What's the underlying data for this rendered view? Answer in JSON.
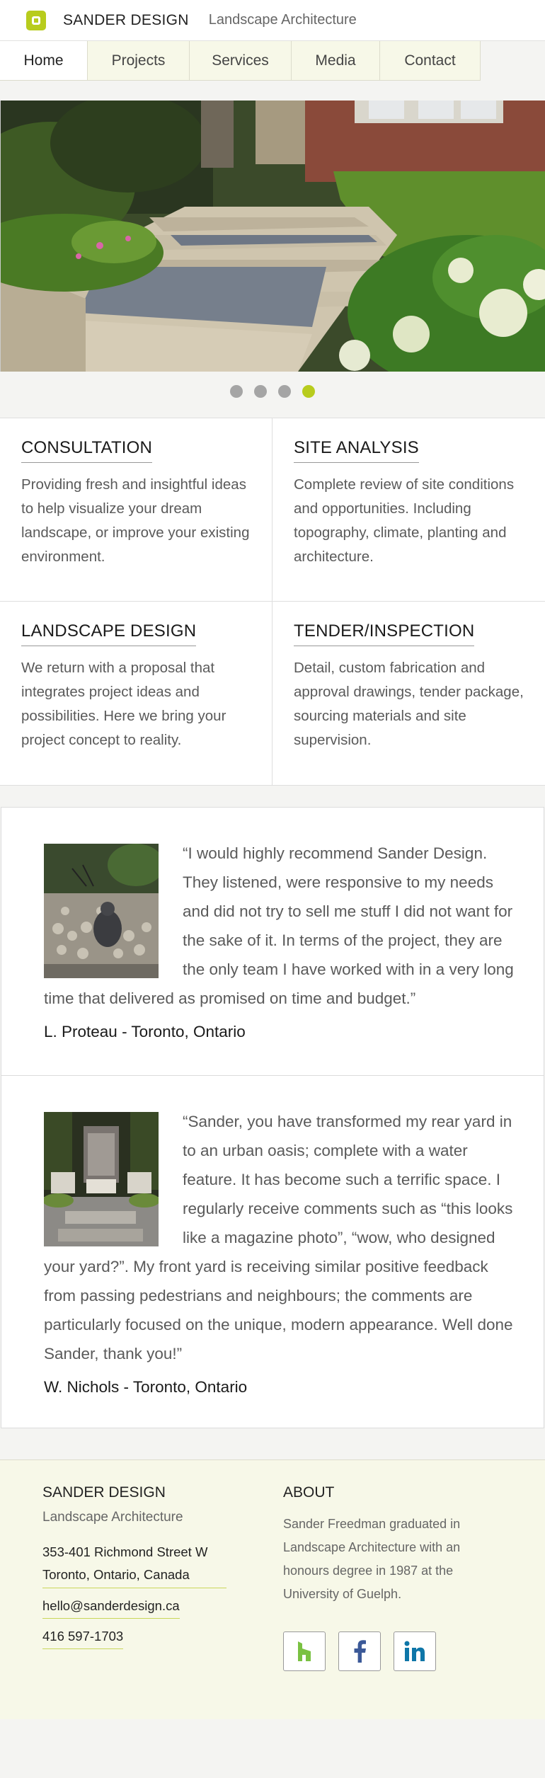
{
  "header": {
    "brand_name": "SANDER DESIGN",
    "brand_tagline": "Landscape Architecture"
  },
  "nav": {
    "items": [
      "Home",
      "Projects",
      "Services",
      "Media",
      "Contact"
    ],
    "active": "Home"
  },
  "slider": {
    "slide_count": 4,
    "active_index": 4
  },
  "services": [
    {
      "title": "CONSULTATION",
      "description": "Providing fresh and insightful ideas to help visualize your dream landscape, or improve your existing environment."
    },
    {
      "title": "SITE ANALYSIS",
      "description": "Complete review of site conditions and opportunities. Including topography, climate, planting and architecture."
    },
    {
      "title": "LANDSCAPE DESIGN",
      "description": "We return with a proposal that integrates project ideas and possibilities. Here we bring your project concept to reality."
    },
    {
      "title": "TENDER/INSPECTION",
      "description": "Detail, custom fabrication and approval drawings, tender package, sourcing materials and site supervision."
    }
  ],
  "testimonials": [
    {
      "quote": "“I would highly recommend Sander Design. They listened, were responsive to my needs and did not try to sell me stuff I did not want for the sake of it. In terms of the project, they are the only team I have worked with in a very long time that delivered as promised on time and budget.”",
      "author": "L. Proteau - Toronto, Ontario"
    },
    {
      "quote": "“Sander, you have transformed my rear yard in to an urban oasis; complete with a water feature. It has become such a terrific space. I regularly receive comments such as “this looks like a magazine photo”, “wow, who designed your yard?”. My front yard is receiving similar positive feedback from passing pedestrians and neighbours; the comments are particularly focused on the unique, modern appearance. Well done Sander, thank you!”",
      "author": "W. Nichols - Toronto, Ontario"
    }
  ],
  "footer": {
    "brand_name": "SANDER DESIGN",
    "brand_tagline": "Landscape Architecture",
    "address_line1": "353-401 Richmond Street W",
    "address_line2": "Toronto, Ontario, Canada",
    "email": "hello@sanderdesign.ca",
    "phone": "416 597-1703",
    "about_title": "ABOUT",
    "about_text": "Sander Freedman graduated in Landscape Architecture with an honours degree in 1987 at the University of Guelph.",
    "social": [
      "houzz-icon",
      "facebook-icon",
      "linkedin-icon"
    ]
  },
  "colors": {
    "accent": "#b8cc1d",
    "footer_bg": "#f7f8e8",
    "facebook": "#3b5998",
    "linkedin": "#0e76a8",
    "houzz": "#7ac142"
  }
}
